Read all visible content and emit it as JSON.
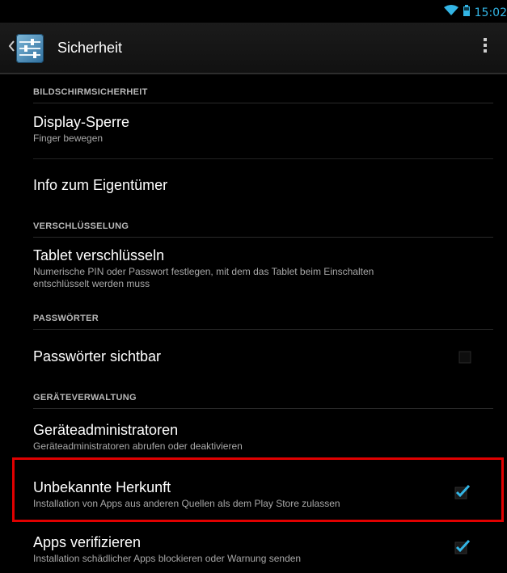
{
  "statusbar": {
    "time": "15:02",
    "icons": [
      "wifi-icon",
      "battery-icon"
    ]
  },
  "actionbar": {
    "title": "Sicherheit",
    "icons": [
      "back-icon",
      "settings-app-icon",
      "overflow-menu-icon"
    ]
  },
  "sections": {
    "screen_security": "BILDSCHIRMSICHERHEIT",
    "encryption": "VERSCHLÜSSELUNG",
    "passwords": "PASSWÖRTER",
    "device_admin": "GERÄTEVERWALTUNG"
  },
  "items": {
    "screen_lock": {
      "title": "Display-Sperre",
      "summary": "Finger bewegen"
    },
    "owner_info": {
      "title": "Info zum Eigentümer"
    },
    "encrypt_tablet": {
      "title": "Tablet verschlüsseln",
      "summary_line1": "Numerische PIN oder Passwort festlegen, mit dem das Tablet beim Einschalten",
      "summary_line2": "entschlüsselt werden muss"
    },
    "show_passwords": {
      "title": "Passwörter sichtbar",
      "checked": false
    },
    "device_admins": {
      "title": "Geräteadministratoren",
      "summary": "Geräteadministratoren abrufen oder deaktivieren"
    },
    "unknown_sources": {
      "title": "Unbekannte Herkunft",
      "summary": "Installation von Apps aus anderen Quellen als dem Play Store zulassen",
      "checked": true
    },
    "verify_apps": {
      "title": "Apps verifizieren",
      "summary": "Installation schädlicher Apps blockieren oder Warnung senden",
      "checked": true
    }
  },
  "colors": {
    "accent": "#33b5e5",
    "highlight": "#e00000",
    "background": "#000000"
  }
}
